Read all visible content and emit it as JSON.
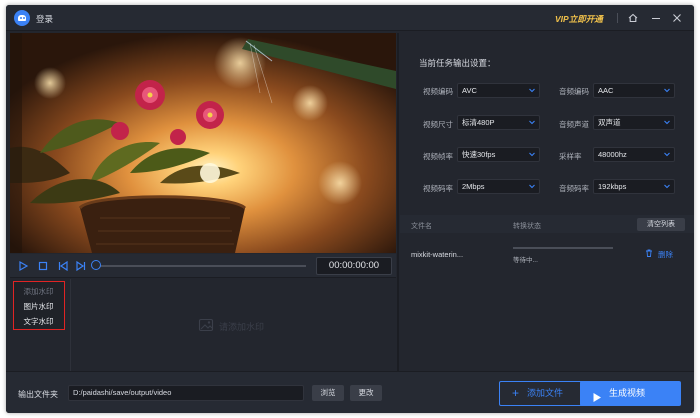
{
  "titlebar": {
    "login": "登录",
    "vip": "VIP立即开通"
  },
  "player": {
    "time": "00:00:00:00",
    "progress": 0
  },
  "watermark": {
    "menu": [
      "添加水印",
      "图片水印",
      "文字水印"
    ],
    "empty_hint": "请添加水印"
  },
  "settings": {
    "title": "当前任务输出设置：",
    "fields": [
      {
        "label": "视频编码",
        "value": "AVC"
      },
      {
        "label": "音频编码",
        "value": "AAC"
      },
      {
        "label": "视频尺寸",
        "value": "标清480P"
      },
      {
        "label": "音频声道",
        "value": "双声道"
      },
      {
        "label": "视频帧率",
        "value": "快速30fps"
      },
      {
        "label": "采样率",
        "value": "48000hz"
      },
      {
        "label": "视频码率",
        "value": "2Mbps"
      },
      {
        "label": "音频码率",
        "value": "192kbps"
      }
    ]
  },
  "filelist": {
    "col_name": "文件名",
    "col_status": "转换状态",
    "clear": "清空列表",
    "rows": [
      {
        "name": "mixkit-waterin...",
        "status": "等待中...",
        "progress": 0,
        "delete": "删除"
      }
    ]
  },
  "output": {
    "label": "输出文件夹",
    "path": "D:/paidashi/save/output/video",
    "browse": "浏览",
    "change": "更改"
  },
  "actions": {
    "add_file": "添加文件",
    "generate": "生成视频"
  },
  "colors": {
    "accent": "#3b82f6",
    "vip": "#f0c14b",
    "highlight_border": "#e02424"
  }
}
